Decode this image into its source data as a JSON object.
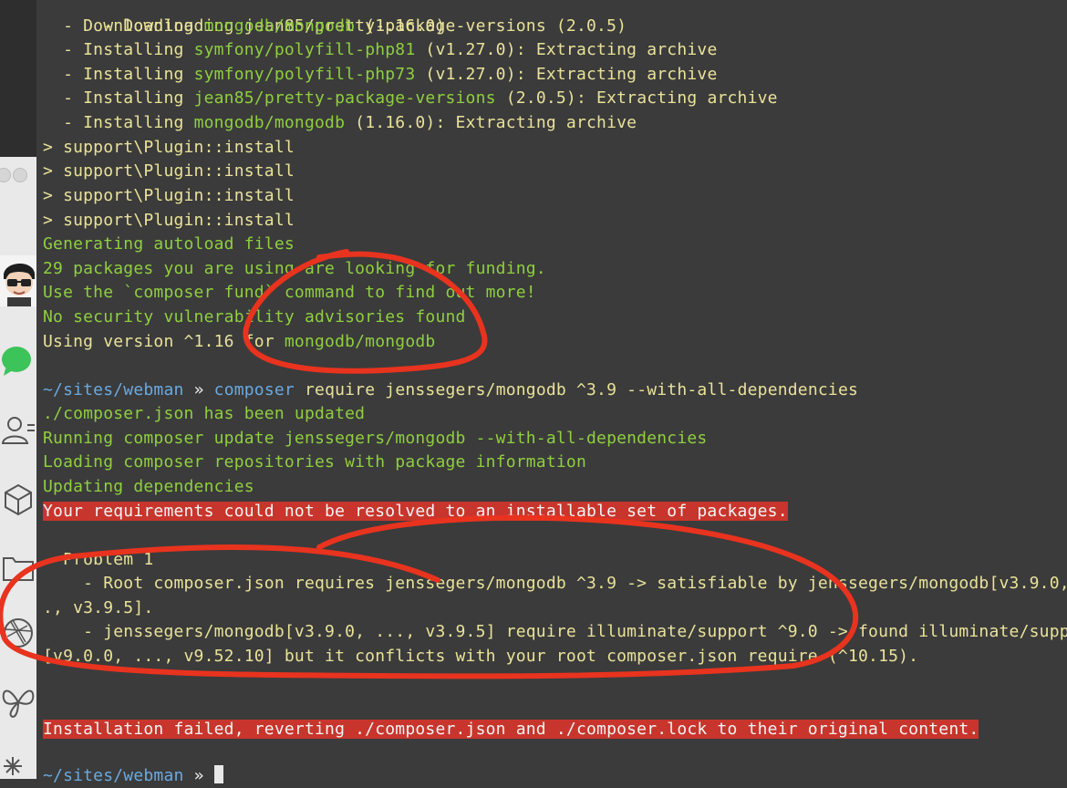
{
  "terminal": {
    "lines": {
      "l0": "  - Downloading jean85/pretty-package-versions (2.0.5)",
      "l1a": "  - Downloading ",
      "l1b": "mongodb/mongodb",
      "l1c": " (1.16.0)",
      "l2a": "  - Installing ",
      "l2b": "symfony/polyfill-php81",
      "l2c": " (v1.27.0): Extracting archive",
      "l3a": "  - Installing ",
      "l3b": "symfony/polyfill-php73",
      "l3c": " (v1.27.0): Extracting archive",
      "l4a": "  - Installing ",
      "l4b": "jean85/pretty-package-versions",
      "l4c": " (2.0.5): Extracting archive",
      "l5a": "  - Installing ",
      "l5b": "mongodb/mongodb",
      "l5c": " (1.16.0): Extracting archive",
      "l6": "> support\\Plugin::install",
      "l7": "> support\\Plugin::install",
      "l8": "> support\\Plugin::install",
      "l9": "> support\\Plugin::install",
      "l10": "Generating autoload files",
      "l11": "29 packages you are using are looking for funding.",
      "l12": "Use the `composer fund` command to find out more!",
      "l13": "No security vulnerability advisories found",
      "l14a": "Using version ^1.16 for ",
      "l14b": "mongodb/mongodb",
      "p1_path": "~/sites/webman",
      "p1_arrow": " » ",
      "p1_cmd": "composer",
      "p1_args": " require jenssegers/mongodb ^3.9 --with-all-dependencies",
      "l16": "./composer.json has been updated",
      "l17": "Running composer update jenssegers/mongodb --with-all-dependencies",
      "l18": "Loading composer repositories with package information",
      "l19": "Updating dependencies",
      "l20": "Your requirements could not be resolved to an installable set of packages.",
      "l21": "  Problem 1",
      "l22": "    - Root composer.json requires jenssegers/mongodb ^3.9 -> satisfiable by jenssegers/mongodb[v3.9.0, .",
      "l23": "., v3.9.5].",
      "l24": "    - jenssegers/mongodb[v3.9.0, ..., v3.9.5] require illuminate/support ^9.0 -> found illuminate/suppo",
      "l25": "[v9.0.0, ..., v9.52.10] but it conflicts with your root composer.json require (^10.15).",
      "l26": "Installation failed, reverting ./composer.json and ./composer.lock to their original content.",
      "p2_path": "~/sites/webman",
      "p2_arrow": " » "
    }
  },
  "colors": {
    "background": "#3b3b3b",
    "green": "#8fcf3f",
    "yellow": "#e9e29a",
    "blue": "#6aa9e0",
    "error_bg": "#c8352c",
    "annotation": "#e8331f"
  },
  "sidebar": {
    "icons": [
      "chat-bubble-icon",
      "contacts-icon",
      "cube-icon",
      "folder-icon",
      "aperture-icon",
      "butterfly-icon",
      "spark-icon"
    ]
  }
}
